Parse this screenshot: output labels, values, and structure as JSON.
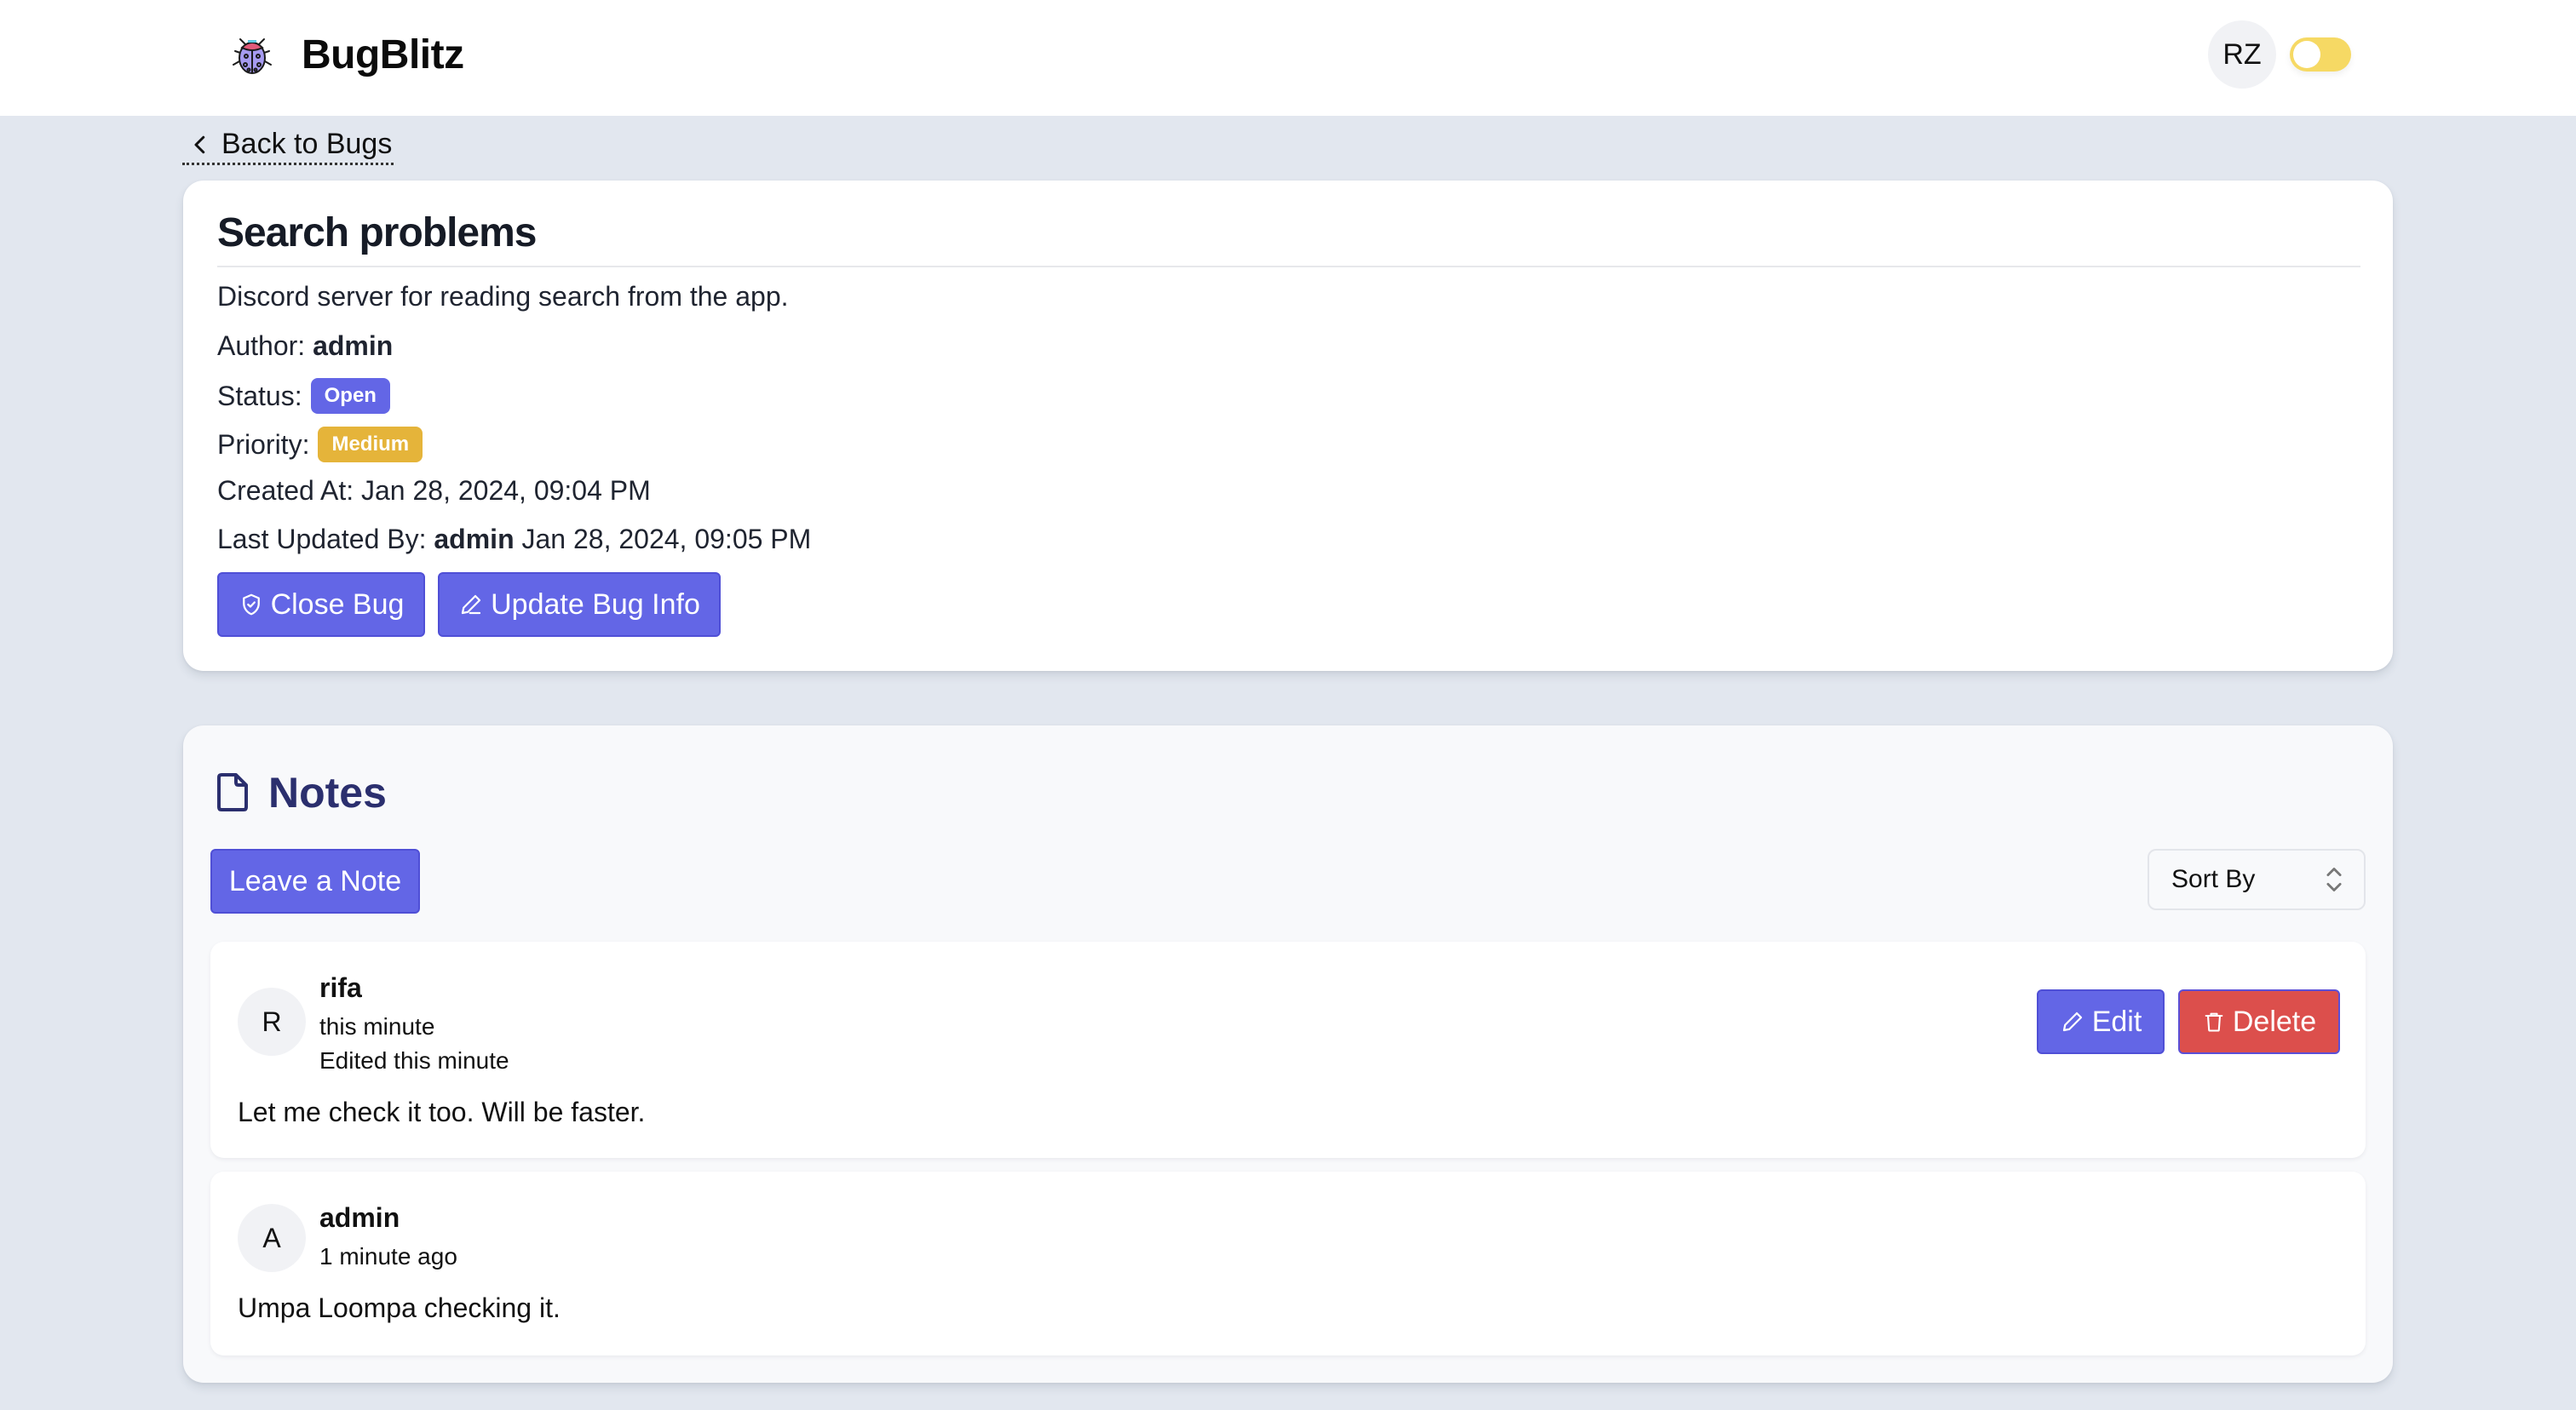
{
  "header": {
    "app_name": "BugBlitz",
    "logo_icon": "ladybug-icon",
    "user_initials": "RZ",
    "theme_toggle": {
      "state": "off",
      "color": "#f6d964"
    }
  },
  "nav": {
    "back_label": "Back to Bugs"
  },
  "bug": {
    "title": "Search problems",
    "description": "Discord server for reading search from the app.",
    "author_label": "Author: ",
    "author": "admin",
    "status_label": "Status:",
    "status": "Open",
    "status_color": "#6366e6",
    "priority_label": "Priority:",
    "priority": "Medium",
    "priority_color": "#e5b43a",
    "created_label": "Created At: ",
    "created_at": "Jan 28, 2024, 09:04 PM",
    "updated_label": "Last Updated By: ",
    "updated_by": "admin",
    "updated_at": " Jan 28, 2024, 09:05 PM",
    "actions": {
      "close_label": "Close Bug",
      "update_label": "Update Bug Info"
    }
  },
  "notes": {
    "title": "Notes",
    "leave_note_label": "Leave a Note",
    "sort_label": "Sort By",
    "items": [
      {
        "initial": "R",
        "author": "rifa",
        "time": "this minute",
        "edited": "Edited this minute",
        "body": "Let me check it too. Will be faster.",
        "edit_label": "Edit",
        "delete_label": "Delete"
      },
      {
        "initial": "A",
        "author": "admin",
        "time": "1 minute ago",
        "body": "Umpa Loompa checking it."
      }
    ]
  },
  "colors": {
    "primary": "#6366e6",
    "danger": "#dc4f4c",
    "page_bg": "#e2e7ef",
    "notes_heading": "#2b2f6e"
  }
}
